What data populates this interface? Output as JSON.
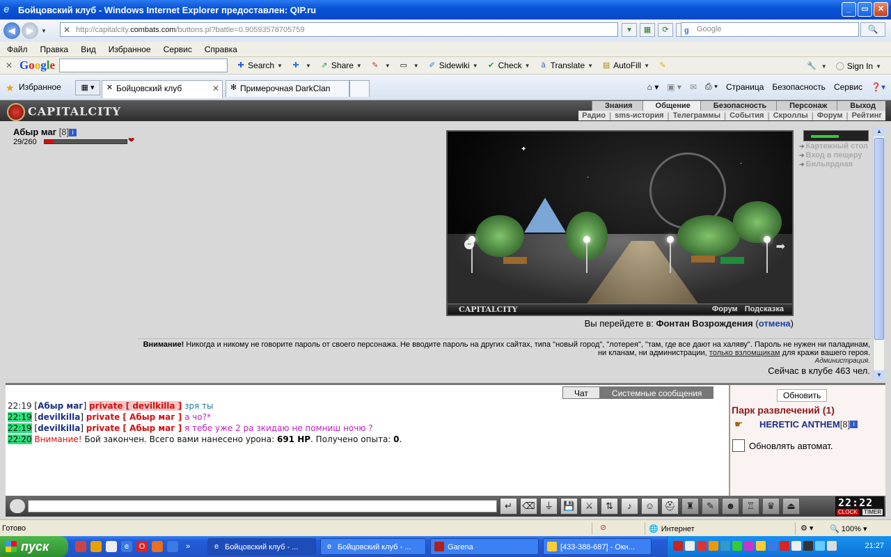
{
  "window": {
    "title": "Бойцовский клуб - Windows Internet Explorer предоставлен: QIP.ru"
  },
  "address": {
    "prefix": "http://capitalcity.",
    "domain": "combats.com",
    "path": "/buttons.pl?battle=0.90593578705759",
    "search_placeholder": "Google"
  },
  "menu": [
    "Файл",
    "Правка",
    "Вид",
    "Избранное",
    "Сервис",
    "Справка"
  ],
  "google_toolbar": {
    "logo": [
      "G",
      "o",
      "o",
      "g",
      "l",
      "e"
    ],
    "buttons": [
      {
        "label": "Search",
        "icon": "search-icon"
      },
      {
        "label": "Share",
        "icon": "share-icon"
      },
      {
        "label": "Sidewiki",
        "icon": "sidewiki-icon"
      },
      {
        "label": "Check",
        "icon": "spellcheck-icon"
      },
      {
        "label": "Translate",
        "icon": "translate-icon"
      },
      {
        "label": "AutoFill",
        "icon": "autofill-icon"
      }
    ],
    "sign_in": "Sign In"
  },
  "favorites": {
    "label": "Избранное",
    "tabs": [
      {
        "label": "Бойцовский клуб",
        "active": true
      },
      {
        "label": "Примерочная DarkClan",
        "active": false
      }
    ],
    "commands": [
      "Страница",
      "Безопасность",
      "Сервис"
    ]
  },
  "game": {
    "logo": "CAPITALCITY",
    "nav_main": [
      "Знания",
      "Общение",
      "Безопасность",
      "Персонаж",
      "Выход"
    ],
    "nav_active": "Общение",
    "nav_sub": [
      "Радио",
      "sms-история",
      "Телеграммы",
      "События",
      "Скроллы",
      "Форум",
      "Рейтинг"
    ],
    "player": {
      "name": "Абыр маг",
      "level": "[8]",
      "hp_text": "29/260",
      "hp_fraction": 0.11
    },
    "scene": {
      "brand": "CAPITALCITY",
      "links": [
        "Форум",
        "Подсказка"
      ]
    },
    "side_links": [
      "Картежный стол",
      "Вход в пещеру",
      "Бильярдная"
    ],
    "goto": {
      "prefix": "Вы перейдете в: ",
      "place": "Фонтан Возрождения",
      "open": " (",
      "cancel": "отмена",
      "close": ")"
    },
    "warning": {
      "bold": "Внимание!",
      "text_a": " Никогда и никому не говорите пароль от своего персонажа. Не вводите пароль на других сайтах, типа \"новый город\", \"лотерея\", \"там, где все дают на халяву\". Пароль не нужен ни паладинам, ни кланам, ни администрации, ",
      "underlined": "только взломщикам",
      "text_b": " для кражи вашего героя."
    },
    "admin_sig": "Администрация.",
    "online": "Сейчас в клубе 463 чел."
  },
  "chat": {
    "tabs": [
      "Чат",
      "Системные сообщения"
    ],
    "lines": [
      {
        "time": "22:19",
        "hl": false,
        "name": "Абыр маг",
        "private": "private [ devilkilla ]",
        "priv_hl": true,
        "msg": " зря ты",
        "msg_class": "msg1"
      },
      {
        "time": "22:19",
        "hl": true,
        "name": "devilkilla",
        "private": "private [ Абыр маг ]",
        "priv_hl": false,
        "msg": " а чо?*",
        "msg_class": "msg2"
      },
      {
        "time": "22:19",
        "hl": true,
        "name": "devilkilla",
        "private": "private [ Абыр маг ]",
        "priv_hl": false,
        "msg": " я тебе уже 2 ра зкидаю не помниш ночю ?",
        "msg_class": "msg2"
      }
    ],
    "system_line": {
      "time": "22:20",
      "warn": "Внимание!",
      "text_a": " Бой закончен. Всего вами нанесено урона: ",
      "damage": "691 HP",
      "text_b": ". Получено опыта: ",
      "exp": "0",
      "end": "."
    }
  },
  "room": {
    "refresh": "Обновить",
    "title": "Парк развлечений (1)",
    "occupant": {
      "name": "HERETIC ANTHEM",
      "level": "[8]"
    },
    "auto_refresh": "Обновлять автомат."
  },
  "gamebar": {
    "icons": [
      "enter-icon",
      "eraser-icon",
      "filter-icon",
      "save-icon",
      "fight-icon",
      "trade-icon",
      "sound-icon",
      "smile-icon",
      "helmet-icon",
      "bag-icon",
      "scroll-icon",
      "mask-icon",
      "castle-icon",
      "cup-icon",
      "exit-icon"
    ],
    "clock": "22:22",
    "clock_label": "CLOCK",
    "timer_label": "TIMER"
  },
  "status": {
    "text": "Готово",
    "zone": "Интернет",
    "zoom": "100%"
  },
  "taskbar": {
    "start": "пуск",
    "tasks": [
      {
        "label": "Бойцовский клуб - ...",
        "active": true
      },
      {
        "label": "Бойцовский клуб - ...",
        "active": false
      },
      {
        "label": "Garena",
        "active": false
      },
      {
        "label": "[433-388-687] - Окн...",
        "active": false
      }
    ],
    "time": "21:27"
  }
}
